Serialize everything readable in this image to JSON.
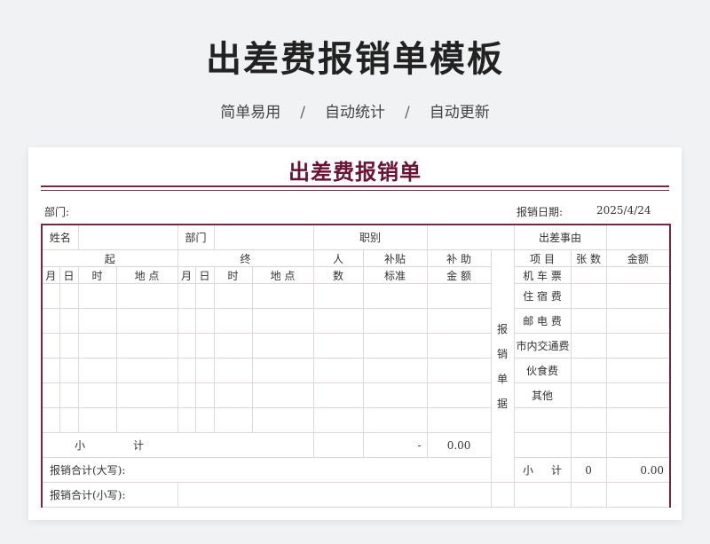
{
  "hero": {
    "title": "出差费报销单模板",
    "subtitle": [
      "简单易用",
      "自动统计",
      "自动更新"
    ],
    "separator": "/"
  },
  "form": {
    "title": "出差费报销单",
    "department_label": "部门:",
    "date_label": "报销日期:",
    "date_value": "2025/4/24",
    "row1": {
      "name_label": "姓名",
      "dept_label": "部门",
      "position_label": "职别",
      "reason_label": "出差事由"
    },
    "headers": {
      "start": "起",
      "end": "终",
      "people": "人",
      "people2": "数",
      "allowance": "补贴",
      "allowance2": "标准",
      "subsidy": "补  助",
      "subsidy2": "金  额",
      "item": "项  目",
      "count": "张 数",
      "amount": "金额",
      "month": "月",
      "day": "日",
      "time": "时",
      "place": "地  点"
    },
    "receipt_vertical": [
      "报",
      "销",
      "单",
      "据"
    ],
    "items": [
      "机 车 票",
      "住 宿 费",
      "邮 电 费",
      "市内交通费",
      "伙食费",
      "其他"
    ],
    "subtotal_left_a": "小",
    "subtotal_left_b": "计",
    "subtotal_dash": "-",
    "subtotal_amount": "0.00",
    "total_upper_label": "报销合计(大写):",
    "total_lower_label": "报销合计(小写):",
    "right_subtotal_a": "小",
    "right_subtotal_b": "计",
    "right_subtotal_count": "0",
    "right_subtotal_amount": "0.00"
  }
}
